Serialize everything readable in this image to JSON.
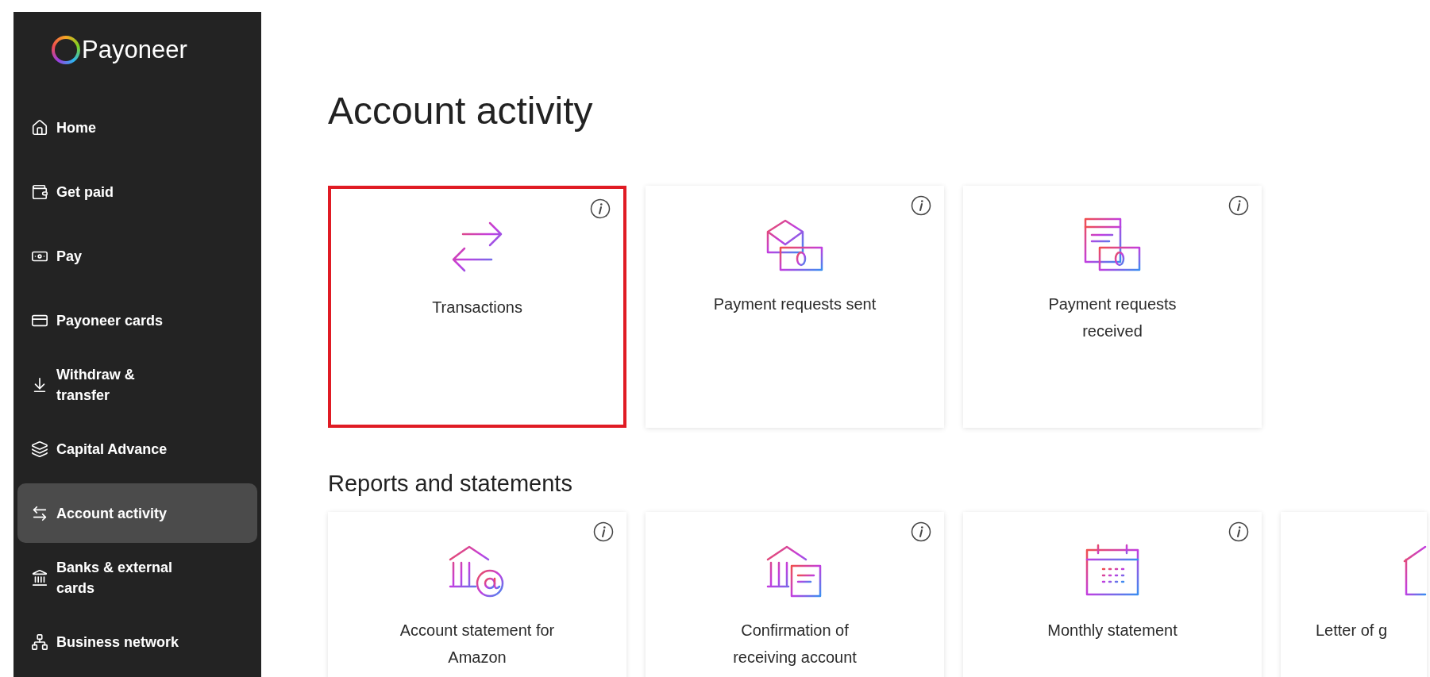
{
  "sidebar": {
    "logo": "Payoneer",
    "items": [
      {
        "label": "Home",
        "selected": false
      },
      {
        "label": "Get paid",
        "selected": false
      },
      {
        "label": "Pay",
        "selected": false
      },
      {
        "label": "Payoneer cards",
        "selected": false
      },
      {
        "label": "Withdraw & transfer",
        "selected": false
      },
      {
        "label": "Capital Advance",
        "selected": false
      },
      {
        "label": "Account activity",
        "selected": true
      },
      {
        "label": "Banks & external cards",
        "selected": false
      },
      {
        "label": "Business network",
        "selected": false
      }
    ]
  },
  "page_title": "Account activity",
  "activity_cards": [
    {
      "label": "Transactions",
      "highlighted": true
    },
    {
      "label": "Payment requests sent",
      "highlighted": false
    },
    {
      "label": "Payment requests received",
      "highlighted": false
    }
  ],
  "reports_title": "Reports and statements",
  "report_cards": [
    {
      "label": "Account statement for Amazon",
      "highlighted": false
    },
    {
      "label": "Confirmation of receiving account",
      "highlighted": false
    },
    {
      "label": "Monthly statement",
      "highlighted": false
    },
    {
      "label": "Letter of g",
      "highlighted": false
    }
  ]
}
